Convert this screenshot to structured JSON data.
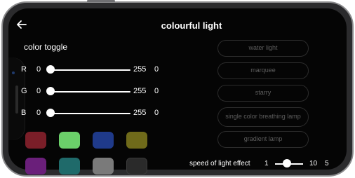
{
  "header": {
    "title": "colourful light",
    "back_icon": "arrow-left-icon"
  },
  "color_toggle": {
    "label": "color toggle",
    "sliders": [
      {
        "channel": "R",
        "min": "0",
        "max": "255",
        "value": "0"
      },
      {
        "channel": "G",
        "min": "0",
        "max": "255",
        "value": "0"
      },
      {
        "channel": "B",
        "min": "0",
        "max": "255",
        "value": "0"
      }
    ],
    "swatches_row1": [
      "#7a1e28",
      "#6bd06a",
      "#1f3a8a",
      "#6f6a1a"
    ],
    "swatches_row2": [
      "#6a1f7a",
      "#1f6a6a",
      "#7a7a7a",
      "#2a2a2a"
    ]
  },
  "modes": [
    {
      "label": "water light"
    },
    {
      "label": "marquee"
    },
    {
      "label": "starry"
    },
    {
      "label": "single color breathing lamp"
    },
    {
      "label": "gradient lamp"
    }
  ],
  "speed": {
    "label": "speed of light effect",
    "min": "1",
    "max": "10",
    "value": "5"
  },
  "colors": {
    "background": "#050505",
    "text": "#ffffff",
    "mode_text": "#5d5d5d"
  }
}
